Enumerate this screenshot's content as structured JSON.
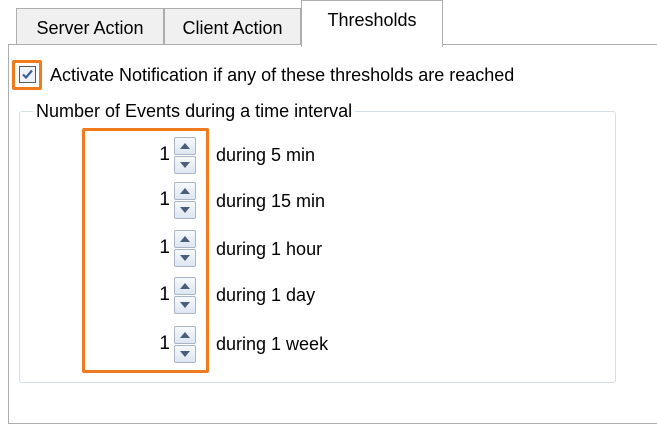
{
  "tabs": [
    {
      "label": "Server Action",
      "selected": false
    },
    {
      "label": "Client Action",
      "selected": false
    },
    {
      "label": "Thresholds",
      "selected": true
    }
  ],
  "activate": {
    "label": "Activate Notification if any of these thresholds are reached",
    "checked": true
  },
  "group": {
    "title": "Number of Events during a time interval",
    "rows": [
      {
        "value": "1",
        "label": "during 5 min"
      },
      {
        "value": "1",
        "label": "during 15 min"
      },
      {
        "value": "1",
        "label": "during 1 hour"
      },
      {
        "value": "1",
        "label": "during 1 day"
      },
      {
        "value": "1",
        "label": "during 1 week"
      }
    ]
  },
  "colors": {
    "highlight": "#f07a1e",
    "check": "#3a5f9b"
  }
}
